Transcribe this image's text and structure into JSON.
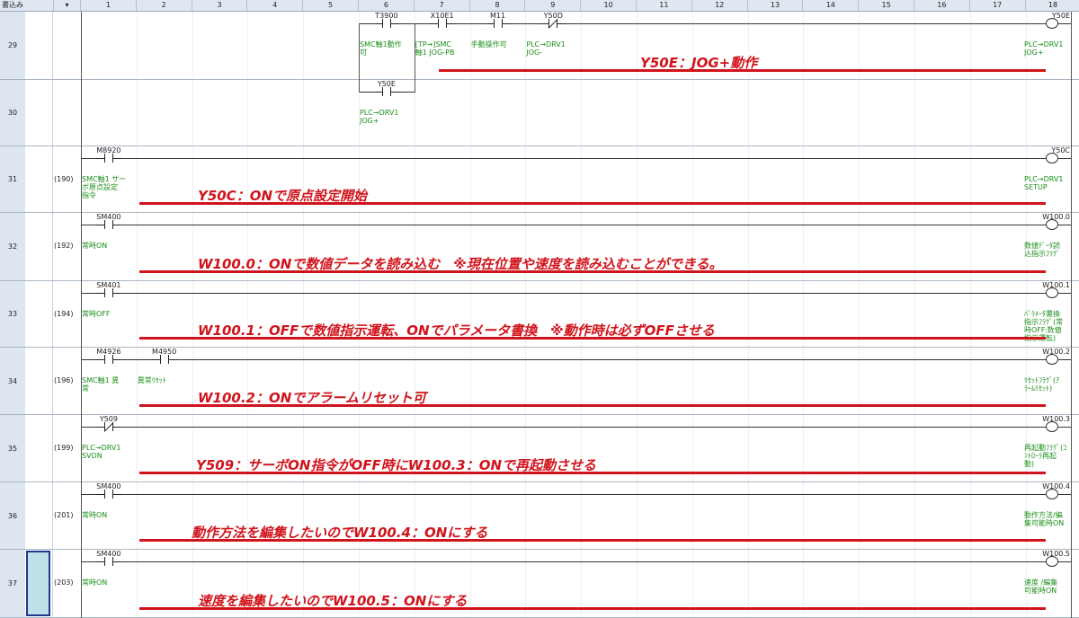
{
  "header": {
    "write_label": "書込み",
    "dropdown": "▾",
    "columns": [
      "1",
      "2",
      "3",
      "4",
      "5",
      "6",
      "7",
      "8",
      "9",
      "10",
      "11",
      "12",
      "13",
      "14",
      "15",
      "16",
      "17",
      "18"
    ]
  },
  "rows": [
    {
      "num": "29",
      "step": "",
      "contacts": [
        {
          "dev": "T3900",
          "cmt": [
            "SMC軸1動作",
            "可"
          ],
          "nc": false
        },
        {
          "dev": "X10E1",
          "cmt": [
            "[TP→]SMC",
            "軸1 JOG-PB"
          ],
          "nc": false
        },
        {
          "dev": "M11",
          "cmt": [
            "手動操作可",
            ""
          ],
          "nc": false
        },
        {
          "dev": "Y50D",
          "cmt": [
            "PLC→DRV1",
            "JOG-"
          ],
          "nc": true
        }
      ],
      "coil": {
        "dev": "Y50E",
        "cmt": [
          "PLC→DRV1",
          "JOG+"
        ]
      },
      "annotation": "Y50E：JOG+動作"
    },
    {
      "num": "30",
      "step": "",
      "contacts": [
        {
          "dev": "Y50E",
          "cmt": [
            "PLC→DRV1",
            "JOG+"
          ],
          "nc": false
        }
      ],
      "coil": null,
      "annotation": ""
    },
    {
      "num": "31",
      "step": "(190)",
      "contacts": [
        {
          "dev": "M8920",
          "cmt": [
            "SMC軸1 サー",
            "ボ原点設定",
            "指令"
          ],
          "nc": false
        }
      ],
      "coil": {
        "dev": "Y50C",
        "cmt": [
          "PLC→DRV1",
          "SETUP"
        ]
      },
      "annotation": "Y50C：ONで原点設定開始"
    },
    {
      "num": "32",
      "step": "(192)",
      "contacts": [
        {
          "dev": "SM400",
          "cmt": [
            "常時ON"
          ],
          "nc": false
        }
      ],
      "coil": {
        "dev": "W100.0",
        "cmt": [
          "数値ﾃﾞｰﾀ読",
          "込指示ﾌﾗｸﾞ"
        ]
      },
      "annotation": "W100.0：ONで数値データを読み込む　※現在位置や速度を読み込むことができる。"
    },
    {
      "num": "33",
      "step": "(194)",
      "contacts": [
        {
          "dev": "SM401",
          "cmt": [
            "常時OFF"
          ],
          "nc": false
        }
      ],
      "coil": {
        "dev": "W100.1",
        "cmt": [
          "ﾊﾟﾗﾒｰﾀ書換",
          "指示ﾌﾗｸﾞ(常",
          "時OFF:数値",
          "指示運転)"
        ]
      },
      "annotation": "W100.1：OFFで数値指示運転、ONでパラメータ書換　※動作時は必ずOFFさせる"
    },
    {
      "num": "34",
      "step": "(196)",
      "contacts": [
        {
          "dev": "M4926",
          "cmt": [
            "SMC軸1 異",
            "常"
          ],
          "nc": false
        },
        {
          "dev": "M4950",
          "cmt": [
            "異常ﾘｾｯﾄ"
          ],
          "nc": false
        }
      ],
      "coil": {
        "dev": "W100.2",
        "cmt": [
          "ﾘｾｯﾄﾌﾗｸﾞ(ｱ",
          "ﾗｰﾑﾘｾｯﾄ)"
        ]
      },
      "annotation": "W100.2：ONでアラームリセット可"
    },
    {
      "num": "35",
      "step": "(199)",
      "contacts": [
        {
          "dev": "Y509",
          "cmt": [
            "PLC→DRV1",
            "SVON"
          ],
          "nc": true
        }
      ],
      "coil": {
        "dev": "W100.3",
        "cmt": [
          "再起動ﾌﾗｸﾞ(ｺ",
          "ﾝﾄﾛｰﾗ再起",
          "動)"
        ]
      },
      "annotation": "Y509：サーボON指令がOFF時にW100.3：ONで再起動させる"
    },
    {
      "num": "36",
      "step": "(201)",
      "contacts": [
        {
          "dev": "SM400",
          "cmt": [
            "常時ON"
          ],
          "nc": false
        }
      ],
      "coil": {
        "dev": "W100.4",
        "cmt": [
          "動作方法/編",
          "集可能時ON"
        ]
      },
      "annotation": "動作方法を編集したいのでW100.4：ONにする"
    },
    {
      "num": "37",
      "step": "(203)",
      "contacts": [
        {
          "dev": "SM400",
          "cmt": [
            "常時ON"
          ],
          "nc": false
        }
      ],
      "coil": {
        "dev": "W100.5",
        "cmt": [
          "速度 /編集",
          "可能時ON"
        ]
      },
      "annotation": "速度を編集したいのでW100.5：ONにする"
    }
  ]
}
